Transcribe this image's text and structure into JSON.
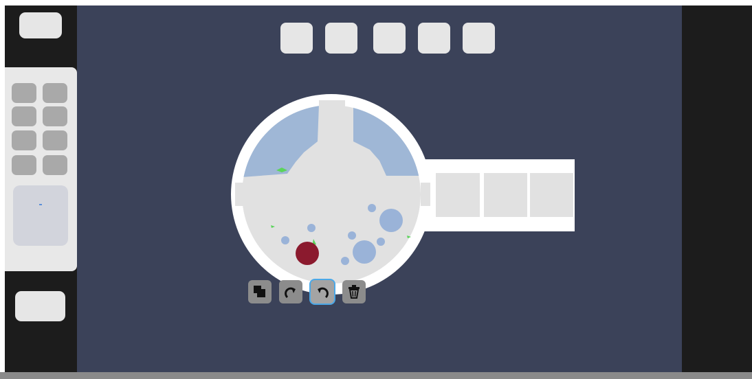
{
  "sidebar": {
    "top_button_icon": "blank-button",
    "slots": [
      "slot",
      "slot",
      "slot",
      "slot",
      "slot",
      "slot",
      "slot",
      "slot"
    ],
    "preview_icon": "level-minimap",
    "bottom_button_icon": "blank-button"
  },
  "toolbar_top": {
    "buttons": [
      "blank-button",
      "blank-button",
      "blank-button",
      "blank-button",
      "blank-button"
    ]
  },
  "context_tools": {
    "buttons": [
      "duplicate-icon",
      "rotate-cw-icon",
      "rotate-ccw-icon",
      "trash-icon"
    ],
    "active_index": 2
  },
  "colors": {
    "canvas": "#3b4259",
    "frame": "#1c1c1c",
    "room_wall": "#ffffff",
    "room_floor": "#e1e1e1",
    "water": "#9fb7d6",
    "bubble": "#9ab3d8",
    "player": "#8b1a2e",
    "plant": "#5bd45b",
    "button": "#e6e6e6",
    "tool": "#8c8c8c",
    "active_outline": "#4aa8e8"
  }
}
